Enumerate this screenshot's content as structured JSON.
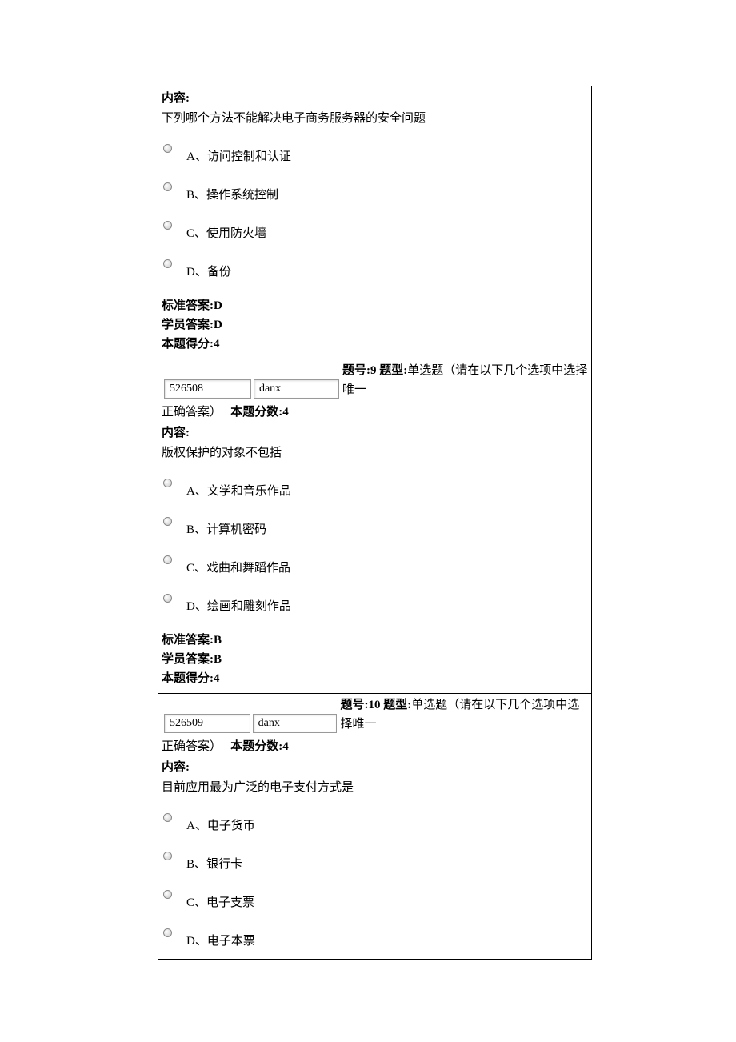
{
  "labels": {
    "content": "内容:",
    "standard_answer": "标准答案:",
    "student_answer": "学员答案:",
    "score_obtained": "本题得分:",
    "question_num": "题号:",
    "question_type": "题型:",
    "question_points": "本题分数:",
    "correct_answer_suffix": "正确答案）"
  },
  "questions": [
    {
      "content_text": "下列哪个方法不能解决电子商务服务器的安全问题",
      "options": [
        "A、访问控制和认证",
        "B、操作系统控制",
        "C、使用防火墙",
        "D、备份"
      ],
      "standard_answer": "D",
      "student_answer": "D",
      "score": "4"
    },
    {
      "id_input": "526508",
      "type_input": "danx",
      "number": "9",
      "type_desc": "单选题（请在以下几个选项中选择唯一",
      "points": "4",
      "content_text": "版权保护的对象不包括",
      "options": [
        "A、文学和音乐作品",
        "B、计算机密码",
        "C、戏曲和舞蹈作品",
        "D、绘画和雕刻作品"
      ],
      "standard_answer": "B",
      "student_answer": "B",
      "score": "4"
    },
    {
      "id_input": "526509",
      "type_input": "danx",
      "number": "10",
      "type_desc": "单选题（请在以下几个选项中选择唯一",
      "points": "4",
      "content_text": "目前应用最为广泛的电子支付方式是",
      "options": [
        "A、电子货币",
        "B、银行卡",
        "C、电子支票",
        "D、电子本票"
      ]
    }
  ]
}
